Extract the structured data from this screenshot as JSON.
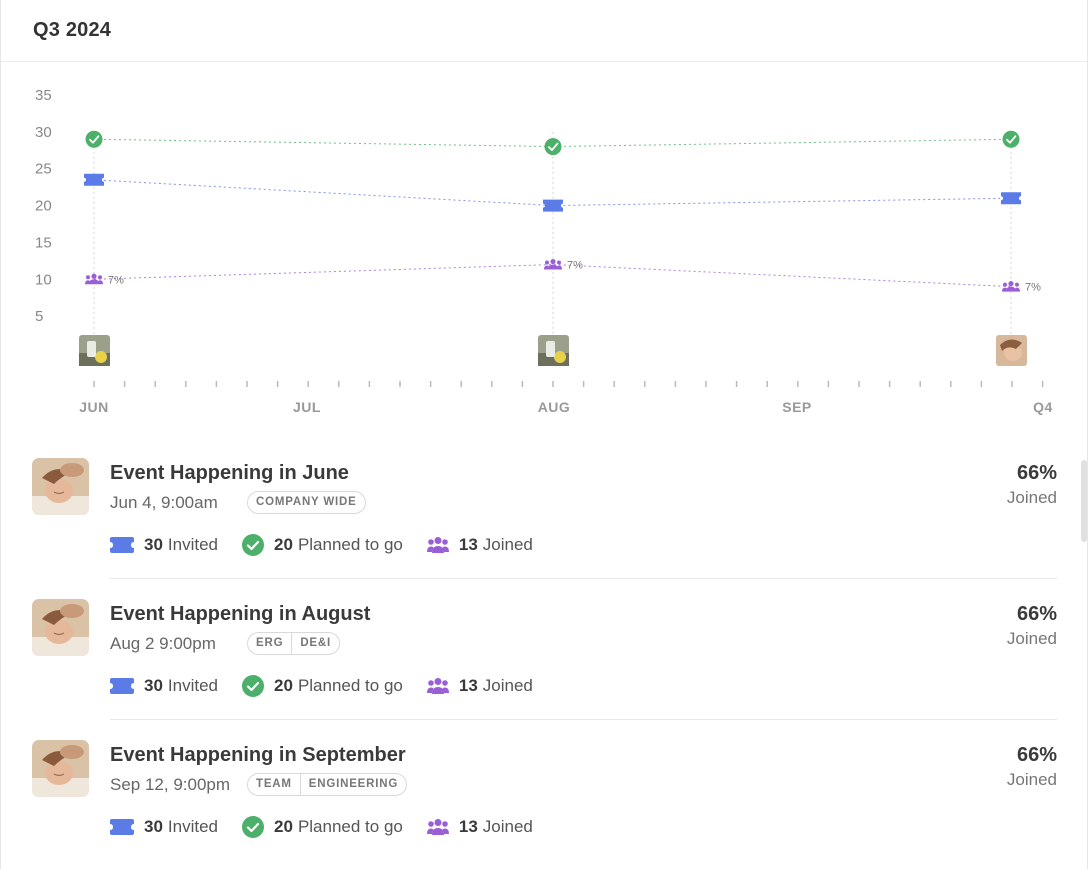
{
  "header": {
    "title": "Q3 2024"
  },
  "colors": {
    "planned": "#4caf6a",
    "invited": "#5b7be6",
    "joined": "#9a5fd6",
    "grid_text": "#888888"
  },
  "icons": {
    "planned": "check-circle-icon",
    "invited": "ticket-icon",
    "joined": "group-icon"
  },
  "chart_data": {
    "type": "line",
    "categories": [
      "JUN",
      "AUG",
      "Q4"
    ],
    "x_axis_labels": [
      "JUN",
      "JUL",
      "AUG",
      "SEP",
      "Q4"
    ],
    "y_ticks": [
      5,
      10,
      15,
      20,
      25,
      30,
      35
    ],
    "ylim": [
      0,
      35
    ],
    "series": [
      {
        "name": "Planned to go",
        "color": "#4caf6a",
        "marker": "check-circle-icon",
        "values": [
          29,
          28,
          29
        ]
      },
      {
        "name": "Invited",
        "color": "#5b7be6",
        "marker": "ticket-icon",
        "values": [
          23.5,
          20,
          21
        ]
      },
      {
        "name": "Joined",
        "color": "#9a5fd6",
        "marker": "group-icon",
        "values": [
          10,
          12,
          9
        ],
        "labels": [
          "7%",
          "7%",
          "7%"
        ]
      }
    ]
  },
  "events": [
    {
      "title": "Event Happening in June",
      "date": "Jun 4, 9:00am",
      "tags": [
        "COMPANY WIDE"
      ],
      "invited_count": "30",
      "invited_label": "Invited",
      "planned_count": "20",
      "planned_label": "Planned to go",
      "joined_count": "13",
      "joined_label": "Joined",
      "percent": "66%",
      "percent_label": "Joined"
    },
    {
      "title": "Event Happening in August",
      "date": "Aug 2 9:00pm",
      "tags": [
        "ERG",
        "DE&I"
      ],
      "invited_count": "30",
      "invited_label": "Invited",
      "planned_count": "20",
      "planned_label": "Planned to go",
      "joined_count": "13",
      "joined_label": "Joined",
      "percent": "66%",
      "percent_label": "Joined"
    },
    {
      "title": "Event Happening in September",
      "date": "Sep 12, 9:00pm",
      "tags": [
        "TEAM",
        "ENGINEERING"
      ],
      "invited_count": "30",
      "invited_label": "Invited",
      "planned_count": "20",
      "planned_label": "Planned to go",
      "joined_count": "13",
      "joined_label": "Joined",
      "percent": "66%",
      "percent_label": "Joined"
    }
  ]
}
